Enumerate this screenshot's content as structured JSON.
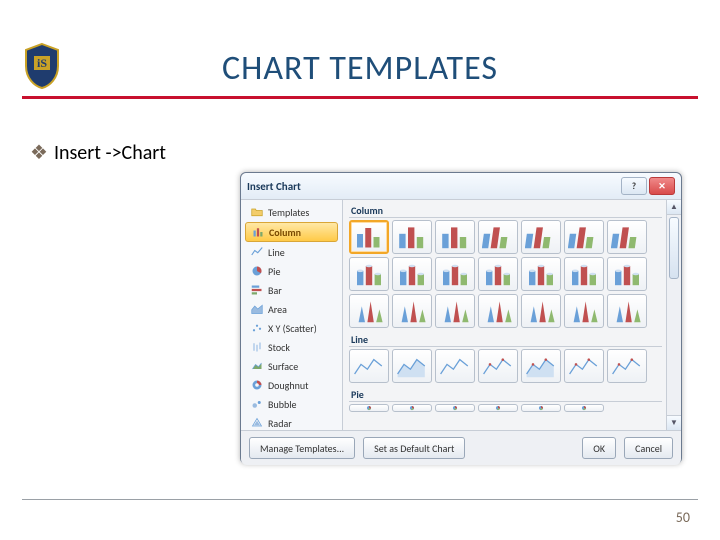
{
  "slide": {
    "title": "CHART TEMPLATES",
    "bullet_text": "Insert ->Chart",
    "page_number": "50"
  },
  "dialog": {
    "title": "Insert Chart",
    "sidebar": [
      {
        "icon": "folder",
        "label": "Templates"
      },
      {
        "icon": "column",
        "label": "Column"
      },
      {
        "icon": "line",
        "label": "Line"
      },
      {
        "icon": "pie",
        "label": "Pie"
      },
      {
        "icon": "bar",
        "label": "Bar"
      },
      {
        "icon": "area",
        "label": "Area"
      },
      {
        "icon": "scatter",
        "label": "X Y (Scatter)"
      },
      {
        "icon": "stock",
        "label": "Stock"
      },
      {
        "icon": "surface",
        "label": "Surface"
      },
      {
        "icon": "doughnut",
        "label": "Doughnut"
      },
      {
        "icon": "bubble",
        "label": "Bubble"
      },
      {
        "icon": "radar",
        "label": "Radar"
      }
    ],
    "sidebar_selected_index": 1,
    "groups": [
      {
        "name": "Column",
        "rows": 3,
        "cols": 7,
        "selected": [
          0,
          0
        ]
      },
      {
        "name": "Line",
        "rows": 1,
        "cols": 7
      },
      {
        "name": "Pie",
        "rows": 1,
        "cols": 6,
        "truncated": true
      }
    ],
    "footer": {
      "manage": "Manage Templates...",
      "set_default": "Set as Default Chart",
      "ok": "OK",
      "cancel": "Cancel"
    }
  }
}
